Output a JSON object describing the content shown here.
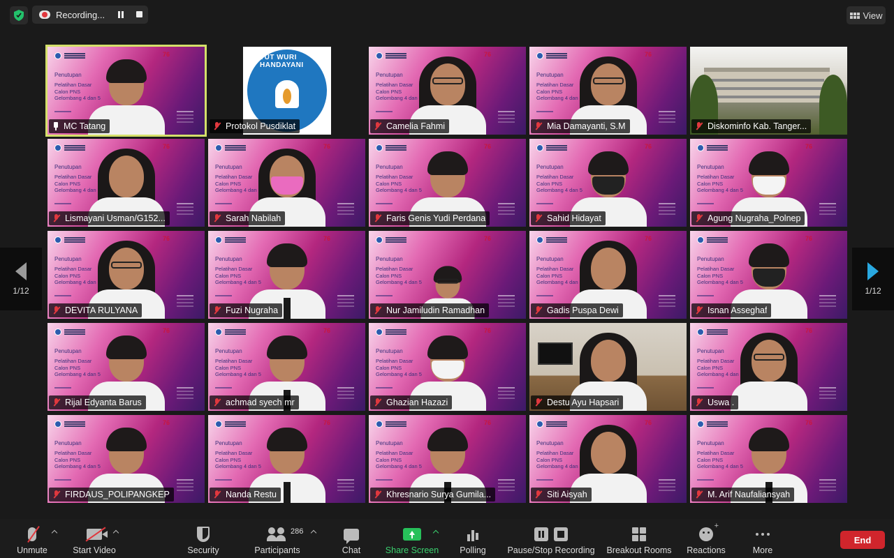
{
  "recording": {
    "label": "Recording..."
  },
  "view_button": {
    "label": "View"
  },
  "pagination": {
    "left": "1/12",
    "right": "1/12"
  },
  "slide": {
    "title": "Penutupan",
    "subtitle_lines": [
      "Pelatihan Dasar",
      "Calon PNS",
      "Gelombang 4 dan 5"
    ],
    "mark": "76"
  },
  "special": {
    "pusdiklat_text": "TUT WURI HANDAYANI"
  },
  "participants": [
    {
      "name": "MC Tatang",
      "kind": "slide",
      "person": "man",
      "active": true,
      "mic": "pin"
    },
    {
      "name": "Protokol Pusdiklat",
      "kind": "pusdiklat",
      "mic": "muted"
    },
    {
      "name": "Camelia Fahmi",
      "kind": "slide",
      "person": "hijab-glasses",
      "mic": "muted"
    },
    {
      "name": "Mia Damayanti, S.M",
      "kind": "slide",
      "person": "hijab-glasses",
      "mic": "muted"
    },
    {
      "name": "Diskominfo Kab. Tanger...",
      "kind": "building",
      "mic": "muted"
    },
    {
      "name": "Lismayani Usman/G152...",
      "kind": "slide",
      "person": "hijab",
      "mic": "muted"
    },
    {
      "name": "Sarah Nabilah",
      "kind": "slide",
      "person": "hijab-pinkmask",
      "mic": "muted"
    },
    {
      "name": "Faris Genis Yudi Perdana",
      "kind": "slide",
      "person": "man",
      "mic": "muted"
    },
    {
      "name": "Sahid Hidayat",
      "kind": "slide",
      "person": "man-blackmask",
      "mic": "muted"
    },
    {
      "name": "Agung Nugraha_Polnep",
      "kind": "slide",
      "person": "man-whitemask",
      "mic": "muted"
    },
    {
      "name": "DEVITA RULYANA",
      "kind": "slide",
      "person": "hijab-glasses",
      "mic": "muted"
    },
    {
      "name": "Fuzi Nugraha",
      "kind": "slide",
      "person": "man-tie",
      "mic": "muted"
    },
    {
      "name": "Nur Jamiludin Ramadhan",
      "kind": "slide",
      "person": "man-glasses-small",
      "mic": "muted"
    },
    {
      "name": "Gadis Puspa Dewi",
      "kind": "slide",
      "person": "hijab",
      "mic": "muted"
    },
    {
      "name": "Isnan Asseghaf",
      "kind": "slide",
      "person": "man-blackmask",
      "mic": "muted"
    },
    {
      "name": "Rijal Edyanta Barus",
      "kind": "slide",
      "person": "man",
      "mic": "muted"
    },
    {
      "name": "achmad syech mr",
      "kind": "slide",
      "person": "man-tie",
      "mic": "muted"
    },
    {
      "name": "Ghazian Hazazi",
      "kind": "slide",
      "person": "man-whitemask",
      "mic": "muted"
    },
    {
      "name": "Destu Ayu Hapsari",
      "kind": "desk",
      "person": "hijab",
      "mic": "muted"
    },
    {
      "name": "Uswa .",
      "kind": "slide",
      "person": "hijab-glasses",
      "mic": "muted"
    },
    {
      "name": "FIRDAUS_POLIPANGKEP",
      "kind": "slide",
      "person": "man",
      "mic": "muted"
    },
    {
      "name": "Nanda Restu",
      "kind": "slide",
      "person": "man-tie",
      "mic": "muted"
    },
    {
      "name": "Khresnario Surya Gumila...",
      "kind": "slide",
      "person": "man-tie",
      "mic": "muted"
    },
    {
      "name": "Siti Aisyah",
      "kind": "slide",
      "person": "hijab",
      "mic": "muted"
    },
    {
      "name": "M. Arif Naufaliansyah",
      "kind": "slide",
      "person": "man-tie",
      "mic": "muted"
    }
  ],
  "toolbar": {
    "unmute": "Unmute",
    "start_video": "Start Video",
    "security": "Security",
    "participants": "Participants",
    "participants_count": "286",
    "chat": "Chat",
    "share_screen": "Share Screen",
    "polling": "Polling",
    "pause_stop_recording": "Pause/Stop Recording",
    "breakout_rooms": "Breakout Rooms",
    "reactions": "Reactions",
    "more": "More",
    "end": "End"
  },
  "colors": {
    "accent_green": "#3bd16f",
    "end_red": "#d0252c",
    "active_speaker": "#d4e06a",
    "muted_red": "#e0383e",
    "next_arrow": "#29a8e0"
  }
}
